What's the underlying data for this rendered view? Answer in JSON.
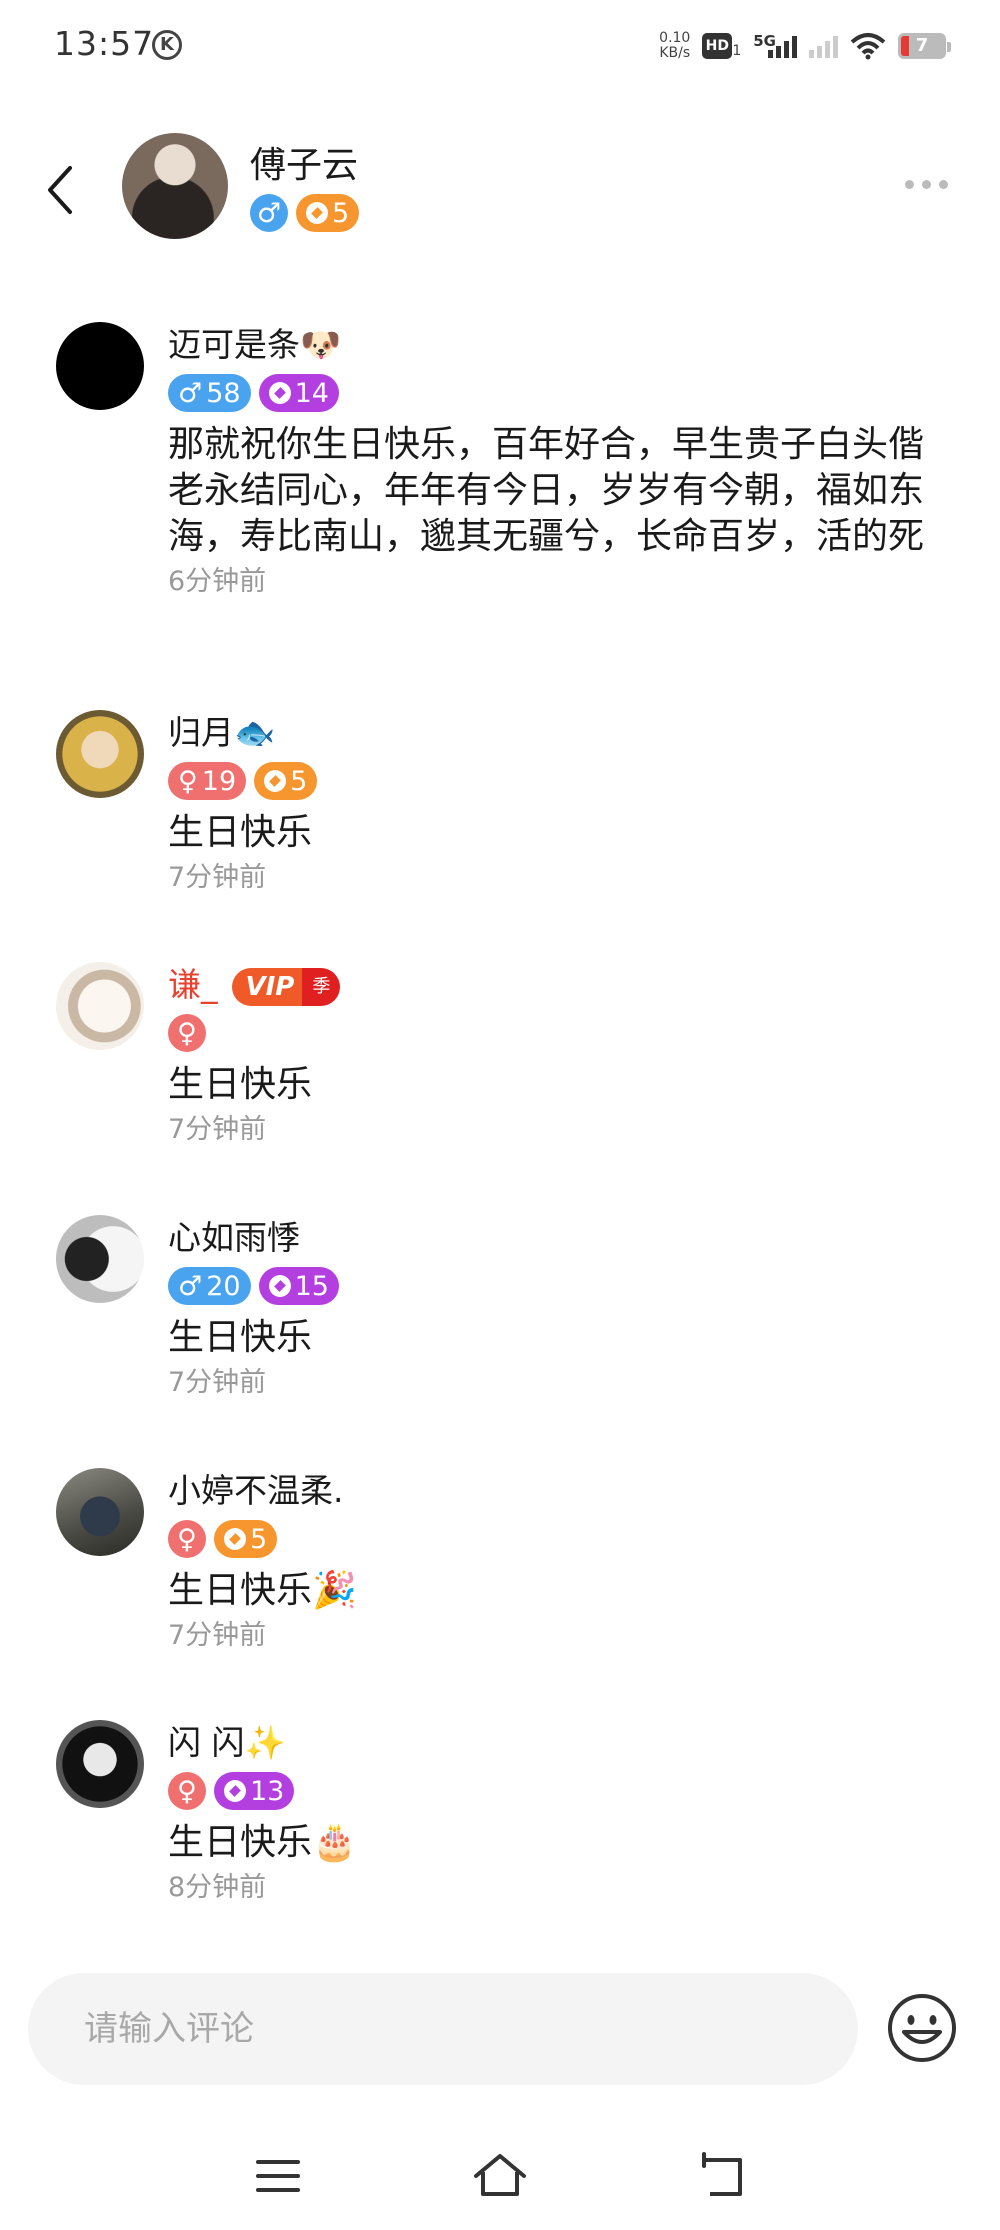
{
  "status_bar": {
    "time": "13:57",
    "k_icon": "K",
    "net_speed_value": "0.10",
    "net_speed_unit": "KB/s",
    "hd_label": "HD",
    "hd_sub": "1",
    "network": "5G",
    "battery": "7"
  },
  "header": {
    "name": "傅子云",
    "level_value": "5",
    "gender": "male"
  },
  "comments": [
    {
      "name": "迈可是条🐶",
      "gender_badge": "58",
      "level_badge": "14",
      "text": "那就祝你生日快乐，百年好合，早生贵子白头偕老永结同心，年年有今日，岁岁有今朝，福如东海，寿比南山，邈其无疆兮，长命百岁，活的死",
      "time": "6分钟前"
    },
    {
      "name": "归月🐟",
      "gender_badge": "19",
      "level_badge": "5",
      "text": "生日快乐",
      "time": "7分钟前"
    },
    {
      "name": "谦_",
      "vip_label": "VIP",
      "vip_season": "季",
      "text": "生日快乐",
      "time": "7分钟前"
    },
    {
      "name": "心如雨悸",
      "gender_badge": "20",
      "level_badge": "15",
      "text": "生日快乐",
      "time": "7分钟前"
    },
    {
      "name": "小婷不温柔.",
      "level_badge": "5",
      "text": "生日快乐🎉",
      "time": "7分钟前"
    },
    {
      "name": "闪 闪✨",
      "level_badge": "13",
      "text": "生日快乐🎂",
      "time": "8分钟前"
    }
  ],
  "input": {
    "placeholder": "请输入评论"
  },
  "colors": {
    "male": "#4aa3ee",
    "female": "#f07070",
    "level_orange": "#f7962e",
    "level_purple": "#b43fe0",
    "vip_name": "#e8412f"
  },
  "icons": {
    "back": "back-arrow-icon",
    "more": "more-dots-icon",
    "emoji": "smiley-face-icon",
    "nav_menu": "menu-lines-icon",
    "nav_home": "home-icon",
    "nav_back": "return-icon"
  }
}
